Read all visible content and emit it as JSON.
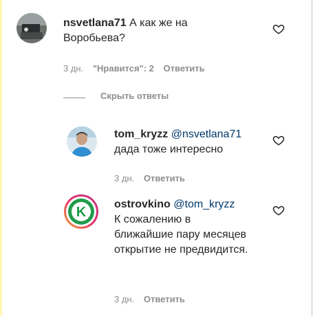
{
  "comments": [
    {
      "username": "nsvetlana71",
      "text": "А как же на Воробьева?",
      "time": "3 дн.",
      "likes_label": "\"Нравится\": 2",
      "reply_label": "Ответить"
    }
  ],
  "hide_replies_label": "Скрыть ответы",
  "replies": [
    {
      "username": "tom_kryzz",
      "mention": "@nsvetlana71",
      "text": "дада тоже интересно",
      "time": "3 дн.",
      "reply_label": "Ответить"
    },
    {
      "username": "ostrovkino",
      "mention": "@tom_kryzz",
      "text": "К сожалению в ближайшие пару месяцев открытие не предвидится.",
      "time": "3 дн.",
      "reply_label": "Ответить",
      "avatar_letter": "K"
    }
  ],
  "colors": {
    "text": "#262626",
    "muted": "#8e8e8e",
    "mention": "#00376b",
    "logo_green": "#1f9c4a"
  },
  "icons": [
    "heart-icon"
  ]
}
